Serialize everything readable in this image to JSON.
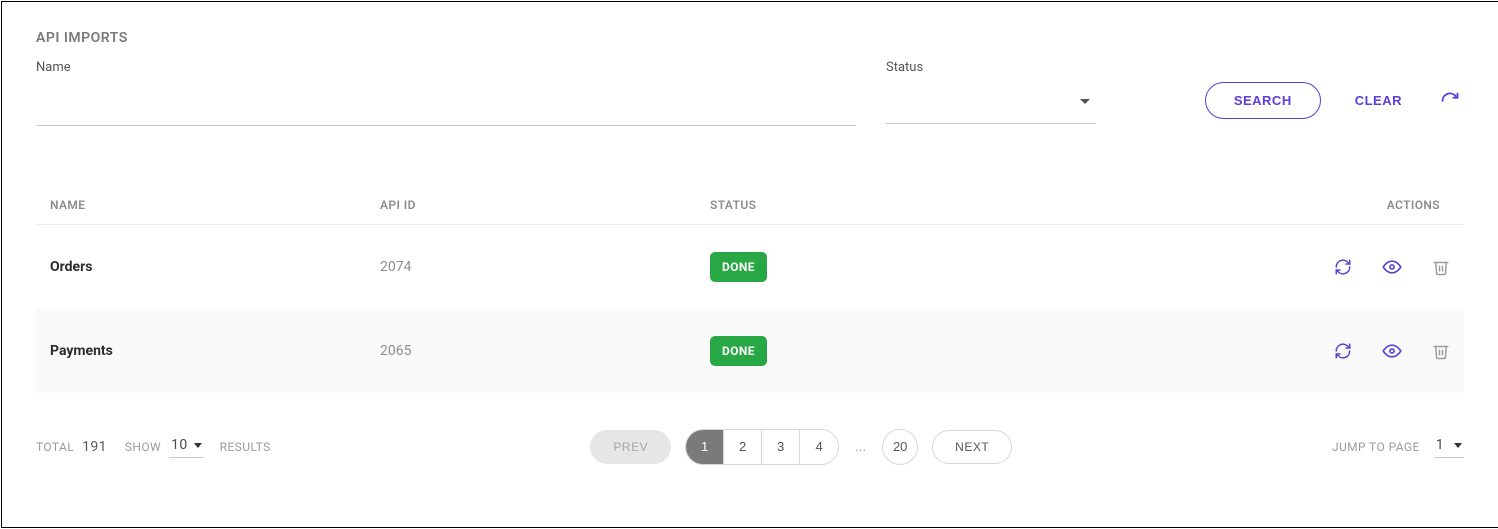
{
  "title": "API IMPORTS",
  "filters": {
    "name_label": "Name",
    "name_value": "",
    "status_label": "Status",
    "status_value": ""
  },
  "actions": {
    "search": "SEARCH",
    "clear": "CLEAR"
  },
  "table": {
    "columns": {
      "name": "NAME",
      "api_id": "API ID",
      "status": "STATUS",
      "actions": "ACTIONS"
    },
    "rows": [
      {
        "name": "Orders",
        "api_id": "2074",
        "status": "DONE"
      },
      {
        "name": "Payments",
        "api_id": "2065",
        "status": "DONE"
      }
    ]
  },
  "status_color": "#27a844",
  "accent_color": "#5b3fd6",
  "pagination": {
    "total_label": "TOTAL",
    "total": "191",
    "show_label": "SHOW",
    "page_size": "10",
    "results_label": "RESULTS",
    "prev": "PREV",
    "next": "NEXT",
    "pages_run": [
      "1",
      "2",
      "3",
      "4"
    ],
    "active_page": "1",
    "ellipsis": "...",
    "last_page": "20",
    "jump_label": "JUMP TO PAGE",
    "jump_value": "1"
  }
}
